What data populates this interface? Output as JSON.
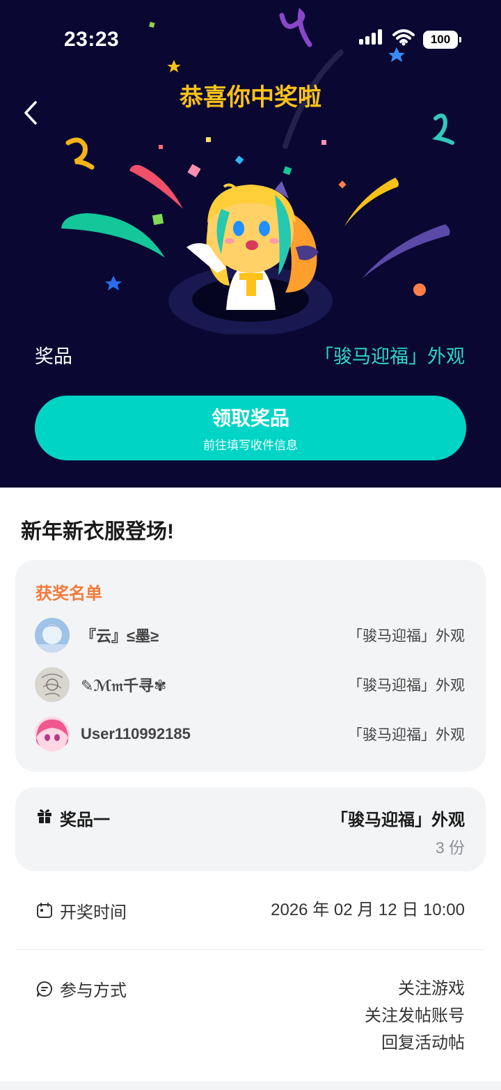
{
  "status_bar": {
    "time": "23:23",
    "battery": "100"
  },
  "hero": {
    "title": "恭喜你中奖啦",
    "prize_label": "奖品",
    "prize_value": "「骏马迎福」外观",
    "claim_button": {
      "label": "领取奖品",
      "sublabel": "前往填写收件信息"
    }
  },
  "post": {
    "title": "新年新衣服登场!"
  },
  "winners": {
    "title": "获奖名单",
    "items": [
      {
        "name": "『云』≤墨≥",
        "prize": "「骏马迎福」外观"
      },
      {
        "name": "✎ℳ𝔪千寻✾",
        "prize": "「骏马迎福」外观"
      },
      {
        "name": "User110992185",
        "prize": "「骏马迎福」外观"
      }
    ]
  },
  "prize_detail": {
    "label": "奖品一",
    "value": "「骏马迎福」外观",
    "count": "3 份"
  },
  "draw_time": {
    "label": "开奖时间",
    "value": "2026 年 02 月 12 日 10:00"
  },
  "participation": {
    "label": "参与方式",
    "methods": [
      "关注游戏",
      "关注发帖账号",
      "回复活动帖"
    ]
  },
  "colors": {
    "hero_bg": "#0a0833",
    "accent_teal": "#00d5c5",
    "title_gold": "#ffc21a",
    "winners_orange": "#f37a3a"
  }
}
